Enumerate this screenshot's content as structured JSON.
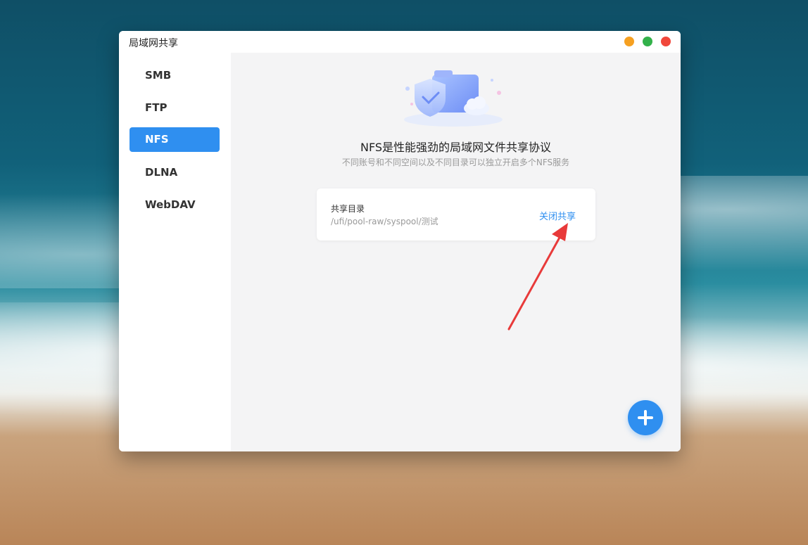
{
  "window": {
    "title": "局域网共享"
  },
  "sidebar": {
    "items": [
      {
        "label": "SMB",
        "active": false
      },
      {
        "label": "FTP",
        "active": false
      },
      {
        "label": "NFS",
        "active": true
      },
      {
        "label": "DLNA",
        "active": false
      },
      {
        "label": "WebDAV",
        "active": false
      }
    ]
  },
  "main": {
    "headline": "NFS是性能强劲的局域网文件共享协议",
    "subline": "不同账号和不同空间以及不同目录可以独立开启多个NFS服务",
    "share_card": {
      "label": "共享目录",
      "path": "/ufi/pool-raw/syspool/测试",
      "action": "关闭共享"
    }
  },
  "colors": {
    "accent": "#2f8ff0",
    "annotation_arrow": "#e83a3a"
  },
  "icons": {
    "fab": "plus-icon",
    "hero": "folder-shield-cloud-illustration",
    "annotation": "red-arrow"
  }
}
